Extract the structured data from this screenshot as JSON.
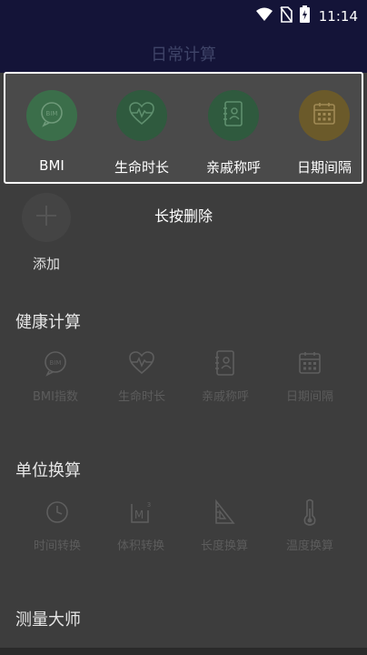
{
  "status": {
    "time": "11:14"
  },
  "appbar": {
    "title": "日常计算"
  },
  "favorites": [
    {
      "label": "BMI",
      "color": "#3b6e4a"
    },
    {
      "label": "生命时长",
      "color": "#2f5a3e"
    },
    {
      "label": "亲戚称呼",
      "color": "#2f5a3e"
    },
    {
      "label": "日期间隔",
      "color": "#6b5a2a"
    }
  ],
  "hint": "长按删除",
  "add": {
    "label": "添加"
  },
  "sections": {
    "health": {
      "title": "健康计算",
      "items": [
        {
          "label": "BMI指数",
          "icon": "bmi-icon"
        },
        {
          "label": "生命时长",
          "icon": "heart-pulse-icon"
        },
        {
          "label": "亲戚称呼",
          "icon": "contacts-icon"
        },
        {
          "label": "日期间隔",
          "icon": "calendar-icon"
        }
      ]
    },
    "units": {
      "title": "单位换算",
      "items": [
        {
          "label": "时间转换",
          "icon": "clock-icon"
        },
        {
          "label": "体积转换",
          "icon": "volume-icon"
        },
        {
          "label": "长度换算",
          "icon": "ruler-triangle-icon"
        },
        {
          "label": "温度换算",
          "icon": "thermometer-icon"
        }
      ]
    },
    "measure": {
      "title": "测量大师"
    }
  }
}
